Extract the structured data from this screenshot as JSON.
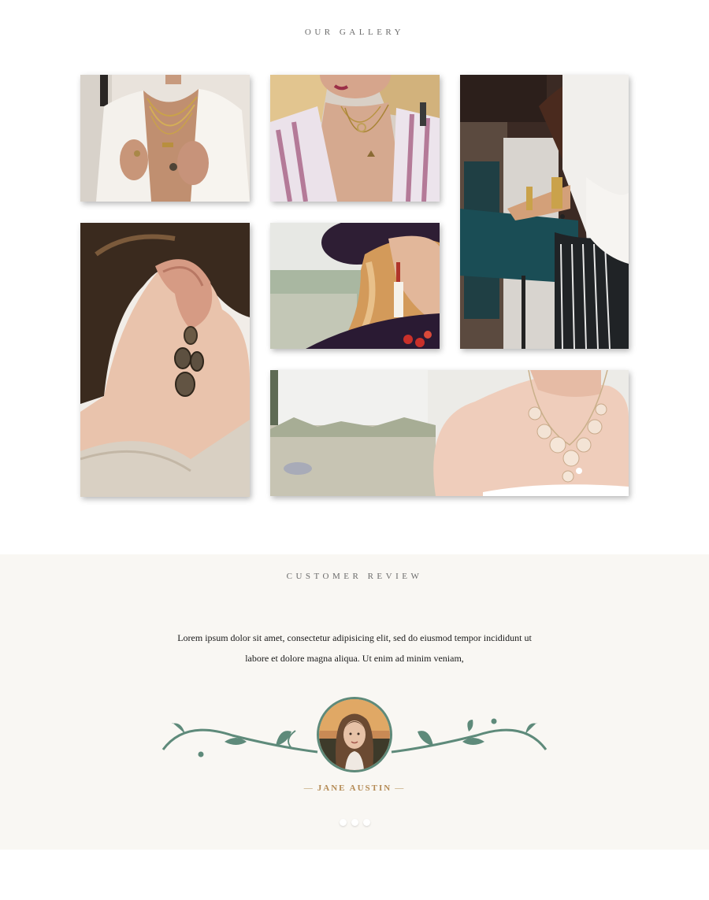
{
  "gallery": {
    "title": "OUR GALLERY",
    "photos": [
      {
        "name": "gold-chain-necklaces-white-blazer"
      },
      {
        "name": "layered-pendant-necklaces-striped-top"
      },
      {
        "name": "gold-bracelets-white-blouse"
      },
      {
        "name": "drop-earring-closeup"
      },
      {
        "name": "tassel-earring-black-hat"
      },
      {
        "name": "floral-crystal-bridal-necklace"
      }
    ]
  },
  "review": {
    "title": "CUSTOMER REVIEW",
    "line1": "Lorem ipsum dolor sit amet, consectetur adipisicing elit, sed do eiusmod tempor incididunt ut",
    "line2": "labore et dolore magna aliqua. Ut enim ad minim veniam,",
    "reviewer_name": "JANE AUSTIN",
    "dash": "—",
    "active_slide": 1,
    "slide_count": 3
  },
  "colors": {
    "accent_green": "#5e8a7a",
    "accent_gold": "#b48a54",
    "review_bg": "#f9f7f3"
  }
}
